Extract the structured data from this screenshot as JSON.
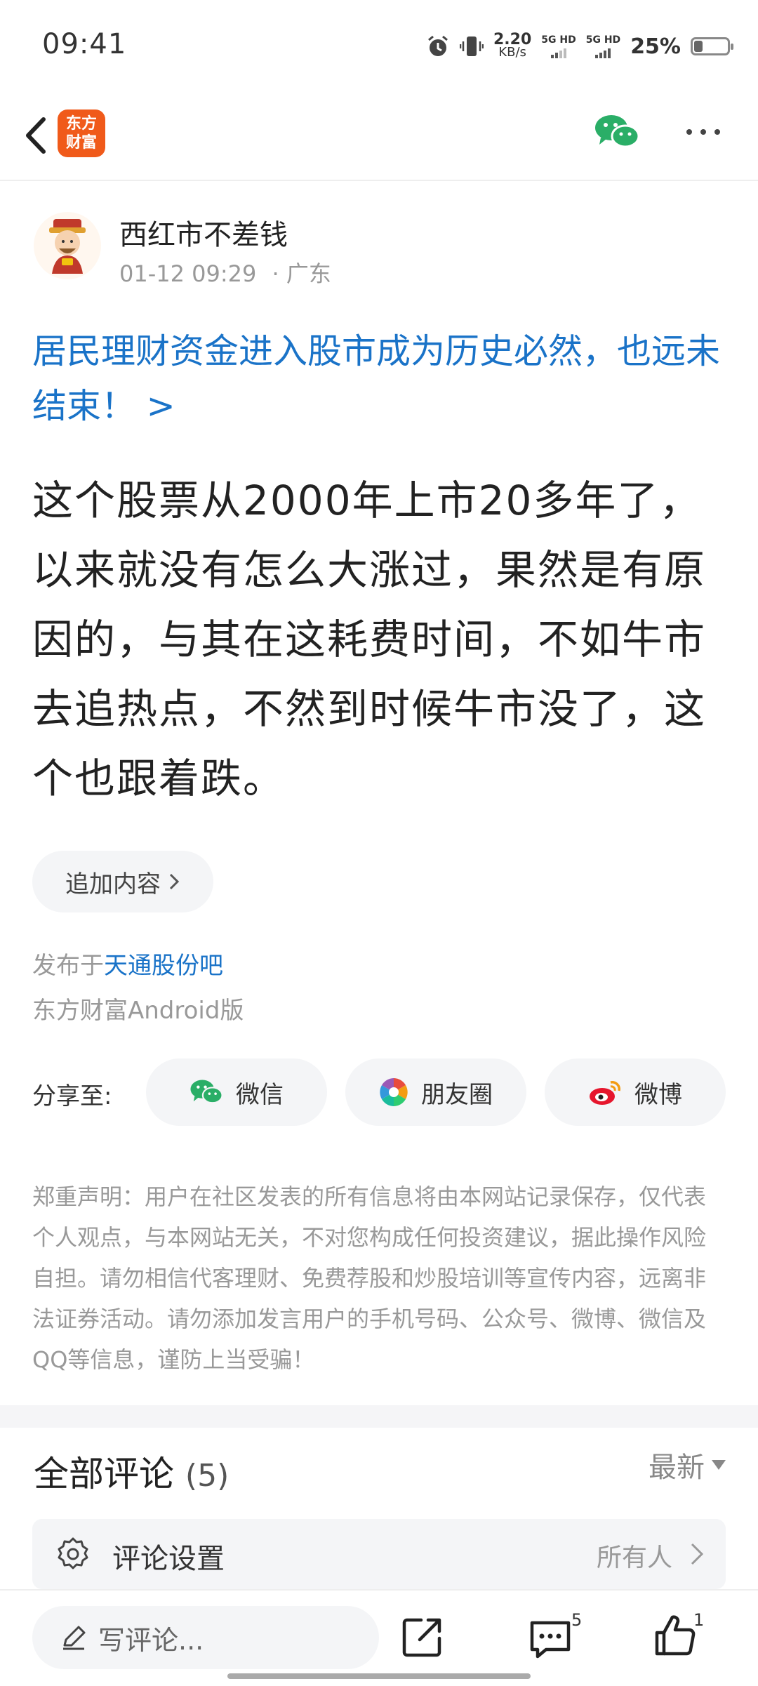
{
  "status_bar": {
    "time": "09:41",
    "net_speed_value": "2.20",
    "net_speed_unit": "KB/s",
    "sim1": "5G HD",
    "sim2": "5G HD",
    "battery_percent": "25%",
    "battery_level": 0.25
  },
  "nav": {
    "logo_line1": "东方",
    "logo_line2": "财富",
    "brand_color": "#f05a1a"
  },
  "post": {
    "author": "西红市不差钱",
    "date": "01-12 09:29",
    "location": "· 广东",
    "headline": "居民理财资金进入股市成为历史必然，也远未结束！ >",
    "body": "这个股票从2000年上市20多年了，以来就没有怎么大涨过，果然是有原因的，与其在这耗费时间，不如牛市去追热点，不然到时候牛市没了，这个也跟着跌。",
    "append_label": "追加内容",
    "published_prefix": "发布于",
    "published_bar": "天通股份吧",
    "client": "东方财富Android版"
  },
  "share": {
    "label": "分享至:",
    "wechat": "微信",
    "moments": "朋友圈",
    "weibo": "微博"
  },
  "disclaimer": "郑重声明：用户在社区发表的所有信息将由本网站记录保存，仅代表个人观点，与本网站无关，不对您构成任何投资建议，据此操作风险自担。请勿相信代客理财、免费荐股和炒股培训等宣传内容，远离非法证券活动。请勿添加发言用户的手机号码、公众号、微博、微信及QQ等信息，谨防上当受骗！",
  "comments": {
    "title": "全部评论",
    "count": "(5)",
    "sort": "最新",
    "settings_label": "评论设置",
    "settings_value": "所有人"
  },
  "bottom_bar": {
    "write_placeholder": "写评论...",
    "comment_count": "5",
    "like_count": "1"
  },
  "colors": {
    "link": "#1a73c8",
    "wechat_green": "#2aae67",
    "weibo_red": "#e6162d"
  }
}
